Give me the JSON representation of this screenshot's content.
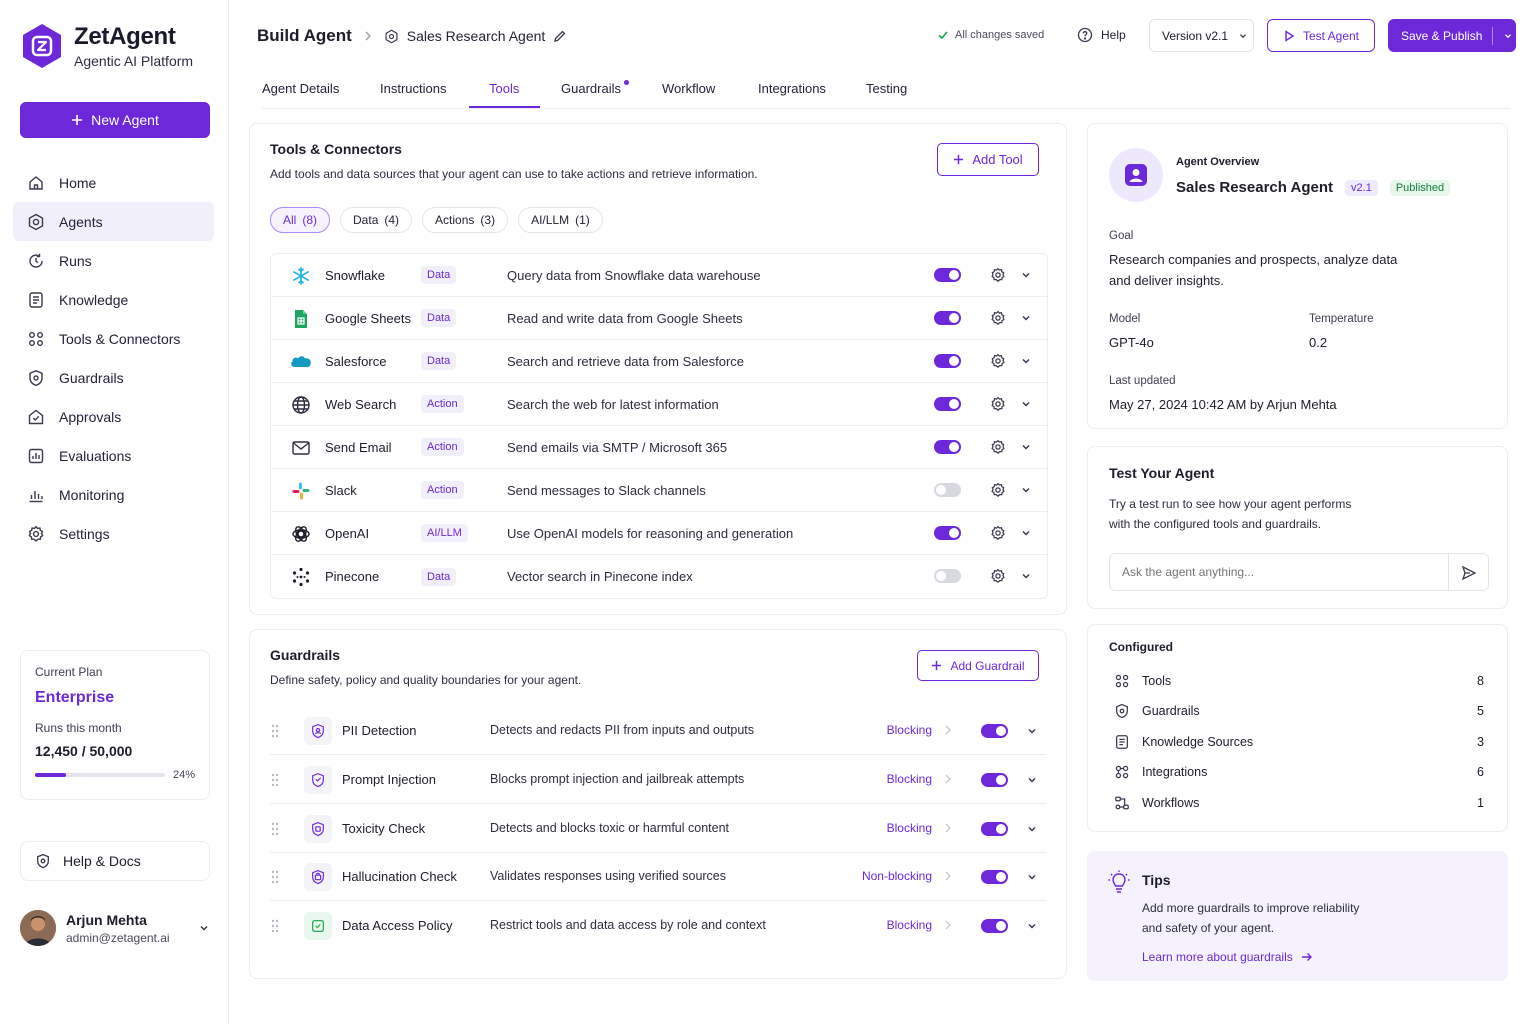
{
  "brand": {
    "name": "ZetAgent",
    "subtitle": "Agentic AI Platform"
  },
  "sidebar": {
    "new_agent_label": "New Agent",
    "items": [
      {
        "label": "Home",
        "icon": "home-icon",
        "active": false
      },
      {
        "label": "Agents",
        "icon": "agents-icon",
        "active": true
      },
      {
        "label": "Runs",
        "icon": "runs-icon",
        "active": false
      },
      {
        "label": "Knowledge",
        "icon": "knowledge-icon",
        "active": false
      },
      {
        "label": "Tools & Connectors",
        "icon": "tools-icon",
        "active": false
      },
      {
        "label": "Guardrails",
        "icon": "shield-icon",
        "active": false
      },
      {
        "label": "Approvals",
        "icon": "approvals-icon",
        "active": false
      },
      {
        "label": "Evaluations",
        "icon": "evaluations-icon",
        "active": false
      },
      {
        "label": "Monitoring",
        "icon": "monitoring-icon",
        "active": false
      },
      {
        "label": "Settings",
        "icon": "gear-icon",
        "active": false
      }
    ],
    "plan": {
      "caption": "Current Plan",
      "name": "Enterprise",
      "runs_label": "Runs this month",
      "runs_value": "12,450 / 50,000",
      "percent_label": "24%",
      "percent": 0.24
    },
    "help_label": "Help & Docs",
    "user": {
      "name": "Arjun Mehta",
      "email": "admin@zetagent.ai"
    }
  },
  "header": {
    "title": "Build Agent",
    "agent_name": "Sales Research Agent",
    "saved_text": "All changes saved",
    "help_label": "Help",
    "version_label": "Version v2.1",
    "test_label": "Test Agent",
    "publish_label": "Save & Publish"
  },
  "tabs": [
    {
      "label": "Agent Details",
      "active": false
    },
    {
      "label": "Instructions",
      "active": false
    },
    {
      "label": "Tools",
      "active": true
    },
    {
      "label": "Guardrails",
      "active": false,
      "dot": true
    },
    {
      "label": "Workflow",
      "active": false
    },
    {
      "label": "Integrations",
      "active": false
    },
    {
      "label": "Testing",
      "active": false
    }
  ],
  "tools_card": {
    "title": "Tools & Connectors",
    "description": "Add tools and data sources that your agent can use to take actions and retrieve information.",
    "add_label": "Add Tool",
    "filters": [
      {
        "label": "All",
        "count": "(8)",
        "active": true
      },
      {
        "label": "Data",
        "count": "(4)",
        "active": false
      },
      {
        "label": "Actions",
        "count": "(3)",
        "active": false
      },
      {
        "label": "AI/LLM",
        "count": "(1)",
        "active": false
      }
    ],
    "tools": [
      {
        "name": "Snowflake",
        "type": "Data",
        "description": "Query data from Snowflake data warehouse",
        "enabled": true,
        "icon": "snowflake-icon"
      },
      {
        "name": "Google Sheets",
        "type": "Data",
        "description": "Read and write data from Google Sheets",
        "enabled": true,
        "icon": "google-sheets-icon"
      },
      {
        "name": "Salesforce",
        "type": "Data",
        "description": "Search and retrieve data from Salesforce",
        "enabled": true,
        "icon": "salesforce-icon"
      },
      {
        "name": "Web Search",
        "type": "Action",
        "description": "Search the web for latest information",
        "enabled": true,
        "icon": "globe-icon"
      },
      {
        "name": "Send Email",
        "type": "Action",
        "description": "Send emails via SMTP / Microsoft 365",
        "enabled": true,
        "icon": "mail-icon"
      },
      {
        "name": "Slack",
        "type": "Action",
        "description": "Send messages to Slack channels",
        "enabled": false,
        "icon": "slack-icon"
      },
      {
        "name": "OpenAI",
        "type": "AI/LLM",
        "description": "Use OpenAI models for reasoning and generation",
        "enabled": true,
        "icon": "openai-icon"
      },
      {
        "name": "Pinecone",
        "type": "Data",
        "description": "Vector search in Pinecone index",
        "enabled": false,
        "icon": "pinecone-icon"
      }
    ]
  },
  "guardrails_card": {
    "title": "Guardrails",
    "description": "Define safety, policy and quality boundaries for your agent.",
    "add_label": "Add Guardrail",
    "items": [
      {
        "name": "PII Detection",
        "description": "Detects and redacts PII from inputs and outputs",
        "mode": "Blocking",
        "enabled": true
      },
      {
        "name": "Prompt Injection",
        "description": "Blocks prompt injection and jailbreak attempts",
        "mode": "Blocking",
        "enabled": true
      },
      {
        "name": "Toxicity Check",
        "description": "Detects and blocks toxic or harmful content",
        "mode": "Blocking",
        "enabled": true
      },
      {
        "name": "Hallucination Check",
        "description": "Validates responses using verified sources",
        "mode": "Non-blocking",
        "enabled": true
      },
      {
        "name": "Data Access Policy",
        "description": "Restrict tools and data access by role and context",
        "mode": "Blocking",
        "enabled": true
      }
    ]
  },
  "overview": {
    "caption": "Agent Overview",
    "name": "Sales Research Agent",
    "version": "v2.1",
    "status": "Published",
    "goal_label": "Goal",
    "goal_line1": "Research companies and prospects, analyze data",
    "goal_line2": "and deliver insights.",
    "model_label": "Model",
    "model": "GPT-4o",
    "temp_label": "Temperature",
    "temperature": "0.2",
    "updated_label": "Last updated",
    "updated": "May 27, 2024 10:42 AM by Arjun Mehta"
  },
  "test_panel": {
    "title": "Test Your Agent",
    "line1": "Try a test run to see how your agent performs",
    "line2": "with the configured tools and guardrails.",
    "placeholder": "Ask the agent anything..."
  },
  "configured": {
    "title": "Configured",
    "items": [
      {
        "label": "Tools",
        "count": "8",
        "icon": "tools-icon"
      },
      {
        "label": "Guardrails",
        "count": "5",
        "icon": "shield-icon"
      },
      {
        "label": "Knowledge Sources",
        "count": "3",
        "icon": "knowledge-icon"
      },
      {
        "label": "Integrations",
        "count": "6",
        "icon": "integrations-icon"
      },
      {
        "label": "Workflows",
        "count": "1",
        "icon": "workflow-icon"
      }
    ]
  },
  "tips": {
    "title": "Tips",
    "line1": "Add more guardrails to improve reliability",
    "line2": "and safety of your agent.",
    "link": "Learn more about guardrails"
  },
  "colors": {
    "accent": "#6d28d9",
    "accent_soft": "#f1effa",
    "published_bg": "#e7f7ec",
    "published_fg": "#15803d"
  }
}
